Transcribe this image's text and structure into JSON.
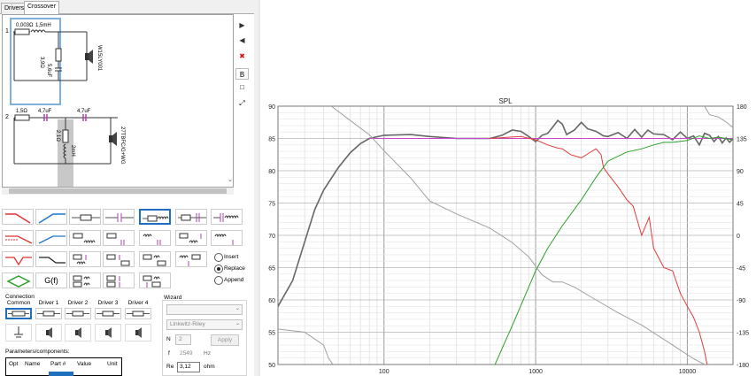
{
  "tabs": [
    {
      "label": "Drivers",
      "active": false
    },
    {
      "label": "Crossover",
      "active": true
    }
  ],
  "schematic": {
    "ch1": {
      "number": "1",
      "r": "0,003Ω",
      "l": "1,5mH",
      "shunt_r": "3,9Ω",
      "shunt_c": "5,6uF",
      "driver": "W15LY001"
    },
    "ch2": {
      "number": "2",
      "r": "1,5Ω",
      "c1": "4,7uF",
      "c2": "4,7uF",
      "shunt_r": "2,1Ω",
      "shunt_l": "2mH",
      "driver": "27TBFC/G+WG"
    }
  },
  "side_toolbar": [
    {
      "name": "move-right",
      "glyph": "▶"
    },
    {
      "name": "move-left",
      "glyph": "◀"
    },
    {
      "name": "delete",
      "glyph": "✖"
    },
    {
      "name": "b",
      "glyph": "B"
    },
    {
      "name": "square",
      "glyph": "□"
    },
    {
      "name": "fit",
      "glyph": "⤢"
    }
  ],
  "palette": {
    "gf_label": "G(f)"
  },
  "insert_mode": {
    "options": [
      "Insert",
      "Replace",
      "Append"
    ],
    "selected": "Replace"
  },
  "connection": {
    "title": "Connection",
    "items": [
      "Common",
      "Driver 1",
      "Driver 2",
      "Driver 3",
      "Driver 4"
    ]
  },
  "params": {
    "title": "Parameters/components:",
    "columns": [
      "Opt",
      "Name",
      "Part #",
      "Value",
      "Unit"
    ]
  },
  "wizard": {
    "title": "Wizard",
    "type_value": "",
    "alignment": "Linkwitz-Riley",
    "n_label": "N",
    "n_value": "2",
    "apply_label": "Apply",
    "f_label": "f",
    "f_value": "2549",
    "f_unit": "Hz",
    "re_label": "Re",
    "re_value": "3,12",
    "re_unit": "ohm"
  },
  "chart_data": {
    "type": "line",
    "title": "SPL",
    "xscale": "log",
    "xlim": [
      20,
      20000
    ],
    "ylim": [
      50,
      90
    ],
    "y2lim": [
      -180,
      180
    ],
    "xticks": [
      100,
      1000,
      10000
    ],
    "xtick_labels": [
      "100",
      "1000",
      "10000"
    ],
    "yticks": [
      50,
      55,
      60,
      65,
      70,
      75,
      80,
      85,
      90
    ],
    "y2ticks": [
      -180,
      -135,
      -90,
      -45,
      0,
      45,
      90,
      135,
      180
    ],
    "grid": true,
    "series": [
      {
        "color": "#666666",
        "axis": "left",
        "points": [
          [
            20,
            59
          ],
          [
            25,
            63
          ],
          [
            30,
            69
          ],
          [
            35,
            74
          ],
          [
            40,
            77
          ],
          [
            50,
            80.5
          ],
          [
            60,
            82.8
          ],
          [
            70,
            84.2
          ],
          [
            80,
            85
          ],
          [
            100,
            85.5
          ],
          [
            150,
            85.6
          ],
          [
            200,
            85.3
          ],
          [
            300,
            85
          ],
          [
            400,
            85
          ],
          [
            500,
            85
          ],
          [
            600,
            85.5
          ],
          [
            700,
            86.3
          ],
          [
            800,
            86.1
          ],
          [
            900,
            85.3
          ],
          [
            1000,
            84.5
          ],
          [
            1100,
            85.5
          ],
          [
            1200,
            85.8
          ],
          [
            1300,
            86.8
          ],
          [
            1400,
            87.8
          ],
          [
            1500,
            87.2
          ],
          [
            1600,
            85.6
          ],
          [
            1800,
            86.3
          ],
          [
            2000,
            87.5
          ],
          [
            2200,
            86.5
          ],
          [
            2500,
            86.1
          ],
          [
            2800,
            85.4
          ],
          [
            3000,
            85.3
          ],
          [
            3500,
            85.9
          ],
          [
            4000,
            85
          ],
          [
            4500,
            86.4
          ],
          [
            5000,
            85.2
          ],
          [
            5500,
            86.3
          ],
          [
            6000,
            85.7
          ],
          [
            7000,
            85.6
          ],
          [
            8000,
            84.8
          ],
          [
            9000,
            86
          ],
          [
            10000,
            85
          ],
          [
            11000,
            85.4
          ],
          [
            12000,
            84
          ],
          [
            13000,
            85.8
          ],
          [
            14000,
            85.5
          ],
          [
            15000,
            84.5
          ],
          [
            16000,
            85.3
          ],
          [
            17000,
            84.3
          ],
          [
            18000,
            85.1
          ],
          [
            19000,
            84.4
          ],
          [
            20000,
            85
          ]
        ]
      },
      {
        "color": "#cc44cc",
        "axis": "left",
        "points": [
          [
            80,
            85
          ],
          [
            20000,
            85
          ]
        ]
      },
      {
        "color": "#e03c3c",
        "axis": "left",
        "points": [
          [
            500,
            85
          ],
          [
            800,
            85.3
          ],
          [
            1000,
            84.8
          ],
          [
            1200,
            84
          ],
          [
            1400,
            83.5
          ],
          [
            1500,
            83.4
          ],
          [
            1700,
            82.5
          ],
          [
            2000,
            82
          ],
          [
            2200,
            82.6
          ],
          [
            2500,
            83.4
          ],
          [
            2700,
            82.5
          ],
          [
            2800,
            80.5
          ],
          [
            3000,
            79.5
          ],
          [
            3500,
            77.5
          ],
          [
            4000,
            75.5
          ],
          [
            4400,
            74.5
          ],
          [
            5000,
            70
          ],
          [
            5600,
            72.8
          ],
          [
            6000,
            68
          ],
          [
            7000,
            65
          ],
          [
            8000,
            64.5
          ],
          [
            9000,
            61
          ],
          [
            10000,
            59
          ],
          [
            11000,
            57.3
          ],
          [
            12000,
            55
          ],
          [
            13000,
            52
          ],
          [
            13500,
            50
          ]
        ]
      },
      {
        "color": "#2aa02a",
        "axis": "left",
        "points": [
          [
            540,
            50
          ],
          [
            700,
            56
          ],
          [
            900,
            62
          ],
          [
            1000,
            64.5
          ],
          [
            1200,
            68
          ],
          [
            1500,
            71.5
          ],
          [
            2000,
            75.5
          ],
          [
            2500,
            79
          ],
          [
            3000,
            81.5
          ],
          [
            4000,
            82.9
          ],
          [
            5000,
            83.4
          ],
          [
            6000,
            84
          ],
          [
            7000,
            84.4
          ],
          [
            8000,
            84.4
          ],
          [
            10000,
            84.7
          ],
          [
            12000,
            85.4
          ],
          [
            14000,
            85
          ],
          [
            16000,
            85.2
          ],
          [
            20000,
            84.8
          ]
        ]
      },
      {
        "color": "#a0a0a0",
        "axis": "left",
        "points": [
          [
            20,
            55.5
          ],
          [
            30,
            55
          ],
          [
            40,
            53
          ],
          [
            43,
            51
          ],
          [
            46,
            50
          ]
        ]
      },
      {
        "color": "#a0a0a0",
        "axis": "right",
        "points": [
          [
            45,
            180
          ],
          [
            60,
            160
          ],
          [
            80,
            140
          ],
          [
            100,
            118
          ],
          [
            150,
            80
          ],
          [
            200,
            48
          ],
          [
            300,
            30
          ],
          [
            500,
            10
          ],
          [
            700,
            -10
          ],
          [
            900,
            -30
          ],
          [
            1100,
            -55
          ],
          [
            1300,
            -65
          ],
          [
            1500,
            -65
          ],
          [
            1800,
            -72
          ],
          [
            2500,
            -90
          ],
          [
            3500,
            -108
          ],
          [
            5000,
            -125
          ],
          [
            7000,
            -145
          ],
          [
            9000,
            -160
          ],
          [
            11000,
            -172
          ],
          [
            13000,
            -180
          ]
        ]
      },
      {
        "color": "#a0a0a0",
        "axis": "right",
        "points": [
          [
            13000,
            180
          ],
          [
            14000,
            168
          ],
          [
            16000,
            165
          ],
          [
            18000,
            158
          ],
          [
            20000,
            150
          ]
        ]
      }
    ]
  }
}
